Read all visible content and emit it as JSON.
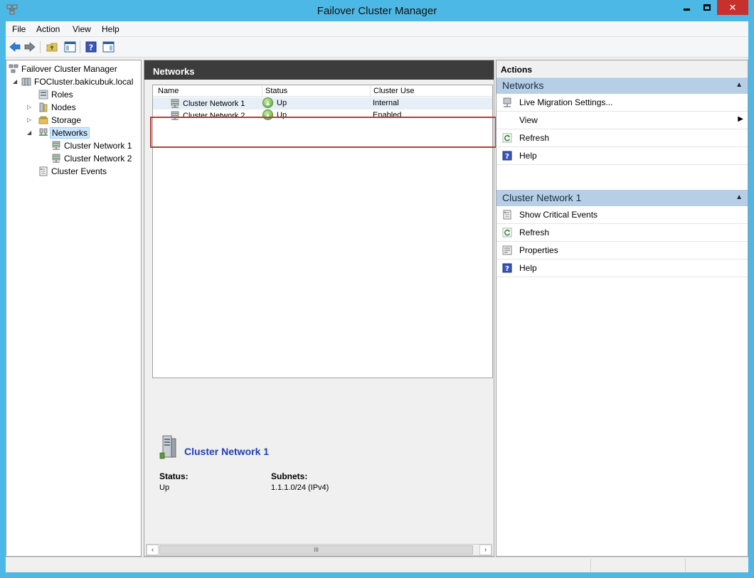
{
  "window": {
    "title": "Failover Cluster Manager"
  },
  "menu": [
    "File",
    "Action",
    "View",
    "Help"
  ],
  "tree": {
    "root": "Failover Cluster Manager",
    "cluster": "FOCluster.bakicubuk.local",
    "items": [
      "Roles",
      "Nodes",
      "Storage",
      "Networks"
    ],
    "networks": [
      "Cluster Network 1",
      "Cluster Network 2"
    ],
    "events": "Cluster Events"
  },
  "center": {
    "header": "Networks",
    "columns": [
      "Name",
      "Status",
      "Cluster Use"
    ],
    "rows": [
      {
        "name": "Cluster Network 1",
        "status": "Up",
        "use": "Internal"
      },
      {
        "name": "Cluster Network 2",
        "status": "Up",
        "use": "Enabled"
      }
    ],
    "details": {
      "title": "Cluster Network 1",
      "status_label": "Status:",
      "status_value": "Up",
      "subnets_label": "Subnets:",
      "subnets_value": "1.1.1.0/24 (IPv4)"
    },
    "scroll_thumb": "III"
  },
  "actions": {
    "title": "Actions",
    "group1": {
      "title": "Networks",
      "items": [
        "Live Migration Settings...",
        "View",
        "Refresh",
        "Help"
      ]
    },
    "group2": {
      "title": "Cluster Network 1",
      "items": [
        "Show Critical Events",
        "Refresh",
        "Properties",
        "Help"
      ]
    }
  },
  "colors": {
    "titlebar": "#4cb8e6",
    "close": "#c7302b",
    "header_dark": "#3c3c3c",
    "action_group": "#b7cfe6",
    "detail_title": "#1f3fb3",
    "highlight": "#b83a3a"
  }
}
